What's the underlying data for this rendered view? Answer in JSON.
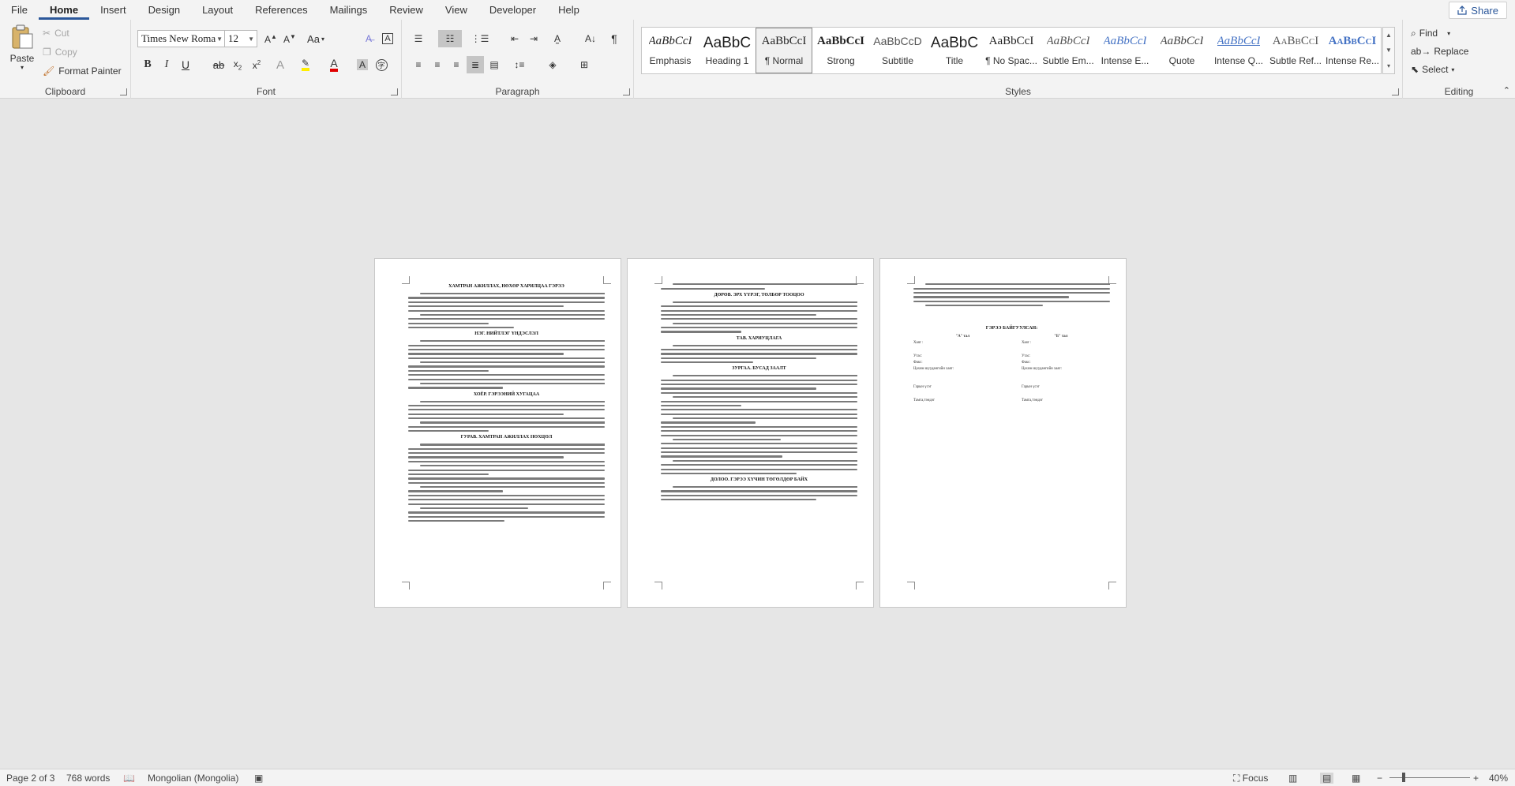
{
  "menu": {
    "tabs": [
      "File",
      "Home",
      "Insert",
      "Design",
      "Layout",
      "References",
      "Mailings",
      "Review",
      "View",
      "Developer",
      "Help"
    ],
    "active_tab": "Home",
    "share_label": "Share"
  },
  "clipboard": {
    "paste": "Paste",
    "cut": "Cut",
    "copy": "Copy",
    "format_painter": "Format Painter",
    "label": "Clipboard"
  },
  "font": {
    "name": "Times New Roma",
    "size": "12",
    "change_case": "Aa",
    "label": "Font"
  },
  "paragraph": {
    "label": "Paragraph"
  },
  "styles": {
    "label": "Styles",
    "items": [
      {
        "preview": "AaBbCcI",
        "name": "Emphasis"
      },
      {
        "preview": "AaBbC",
        "name": "Heading 1"
      },
      {
        "preview": "AaBbCcI",
        "name": "¶ Normal"
      },
      {
        "preview": "AaBbCcI",
        "name": "Strong"
      },
      {
        "preview": "AaBbCcD",
        "name": "Subtitle"
      },
      {
        "preview": "AaBbC",
        "name": "Title"
      },
      {
        "preview": "AaBbCcI",
        "name": "¶ No Spac..."
      },
      {
        "preview": "AaBbCcI",
        "name": "Subtle Em..."
      },
      {
        "preview": "AaBbCcI",
        "name": "Intense E..."
      },
      {
        "preview": "AaBbCcI",
        "name": "Quote"
      },
      {
        "preview": "AaBbCcI",
        "name": "Intense Q..."
      },
      {
        "preview": "AaBbCcI",
        "name": "Subtle Ref..."
      },
      {
        "preview": "AaBbCcI",
        "name": "Intense Re..."
      }
    ],
    "selected_index": 2
  },
  "editing": {
    "find": "Find",
    "replace": "Replace",
    "select": "Select",
    "label": "Editing"
  },
  "document": {
    "page1": {
      "title": "ХАМТРАН АЖИЛЛАХ, НӨХӨР ХАРИЛЦАА ГЭРЭЭ",
      "sections": [
        "НЭГ. НИЙТЛЭГ ҮНДЭСЛЭЛ",
        "ХОЁР. ГЭРЭЭНИЙ ХУГАЦАА",
        "ГУРАВ. ХАМТРАН АЖИЛЛАХ НӨХЦӨЛ"
      ]
    },
    "page2": {
      "sections": [
        "ДӨРӨВ. ЭРХ ҮҮРЭГ, ТӨЛБӨР ТООЦОО",
        "ТАВ. ХАРИУЦЛАГА",
        "ЗУРГАА. БУСАД ЗААЛТ",
        "ДОЛОО. ГЭРЭЭ ХҮЧИН ТӨГӨЛДӨР БАЙХ"
      ]
    },
    "page3": {
      "heading": "ГЭРЭЭ БАЙГУУЛСАН:",
      "party_a": "\"А\" тал",
      "party_b": "\"Б\" тал",
      "rows": [
        "Хаяг :",
        "Утас:",
        "Факс:",
        "Цахим шуудангийн хаяг:",
        "Гарын үсэг",
        "Тамга,тэмдэг"
      ]
    }
  },
  "status": {
    "page": "Page 2 of 3",
    "words": "768 words",
    "language": "Mongolian (Mongolia)",
    "focus": "Focus",
    "zoom": "40%"
  }
}
